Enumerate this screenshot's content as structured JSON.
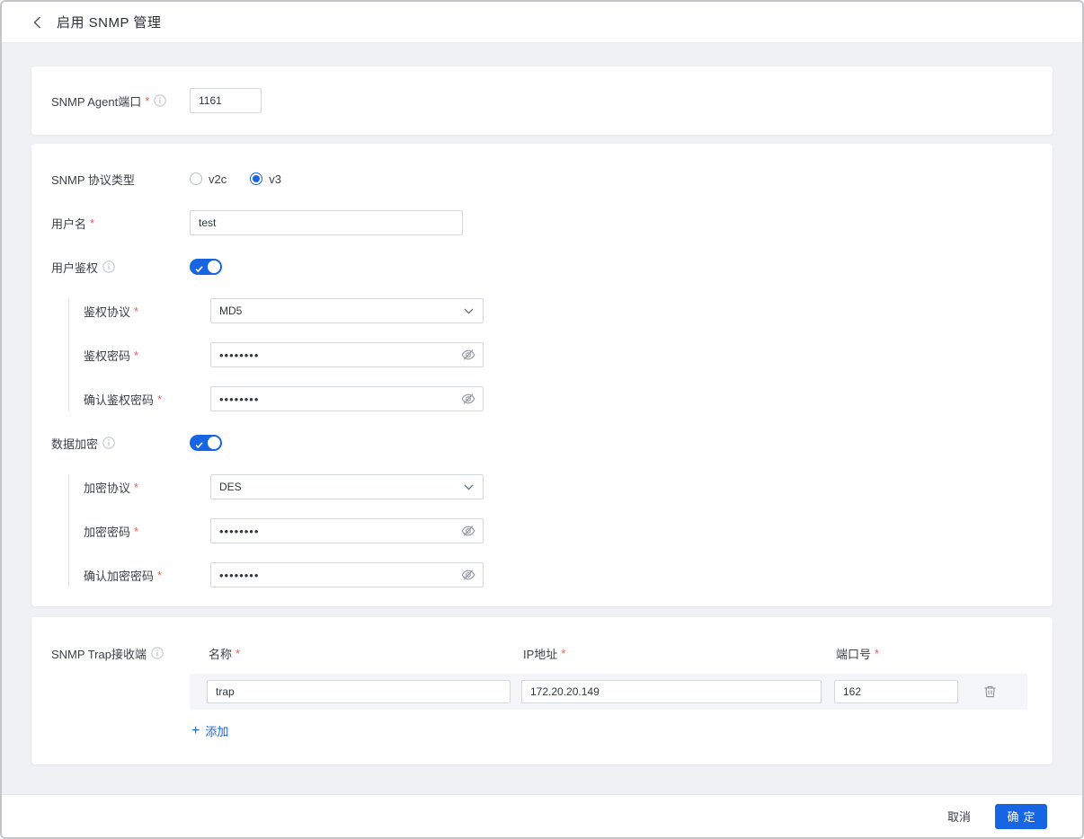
{
  "page": {
    "title": "启用 SNMP 管理"
  },
  "required_mark": "*",
  "colors": {
    "primary": "#1765e3",
    "danger": "#f45b5b",
    "page_bg": "#eff1f5"
  },
  "agent_section": {
    "port_label": "SNMP Agent端口",
    "port_value": "1161"
  },
  "v3_section": {
    "protocol_type_label": "SNMP 协议类型",
    "protocol_options": [
      {
        "label": "v2c",
        "selected": false
      },
      {
        "label": "v3",
        "selected": true
      }
    ],
    "username_label": "用户名",
    "username_value": "test",
    "auth_toggle_label": "用户鉴权",
    "auth_enabled": true,
    "auth_protocol_label": "鉴权协议",
    "auth_protocol_value": "MD5",
    "auth_password_label": "鉴权密码",
    "auth_password_value": "••••••••",
    "auth_confirm_label": "确认鉴权密码",
    "auth_confirm_value": "••••••••",
    "encrypt_toggle_label": "数据加密",
    "encrypt_enabled": true,
    "encrypt_protocol_label": "加密协议",
    "encrypt_protocol_value": "DES",
    "encrypt_password_label": "加密密码",
    "encrypt_password_value": "••••••••",
    "encrypt_confirm_label": "确认加密密码",
    "encrypt_confirm_value": "••••••••"
  },
  "trap_section": {
    "label": "SNMP Trap接收端",
    "columns": {
      "name": "名称",
      "ip": "IP地址",
      "port": "端口号"
    },
    "rows": [
      {
        "name": "trap",
        "ip": "172.20.20.149",
        "port": "162"
      }
    ],
    "add_label": "添加"
  },
  "footer": {
    "cancel_label": "取消",
    "confirm_label": "确定"
  }
}
